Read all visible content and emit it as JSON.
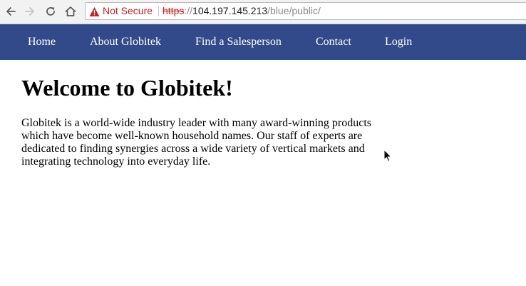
{
  "browser": {
    "security_label": "Not Secure",
    "url": {
      "scheme": "https",
      "separator": "://",
      "host": "104.197.145.213",
      "path": "/blue/public/"
    },
    "icons": {
      "back": "back-arrow-icon",
      "forward": "forward-arrow-icon",
      "reload": "reload-icon",
      "home": "home-icon",
      "warning": "warning-triangle-icon"
    },
    "colors": {
      "warning": "#c5221f"
    }
  },
  "nav": {
    "items": [
      {
        "label": "Home"
      },
      {
        "label": "About Globitek"
      },
      {
        "label": "Find a Salesperson"
      },
      {
        "label": "Contact"
      },
      {
        "label": "Login"
      }
    ],
    "colors": {
      "background": "#324a89",
      "text": "#ffffff"
    }
  },
  "main": {
    "title": "Welcome to Globitek!",
    "intro": "Globitek is a world-wide industry leader with many award-winning products which have become well-known household names. Our staff of experts are dedicated to finding synergies across a wide variety of vertical markets and integrating technology into everyday life."
  }
}
